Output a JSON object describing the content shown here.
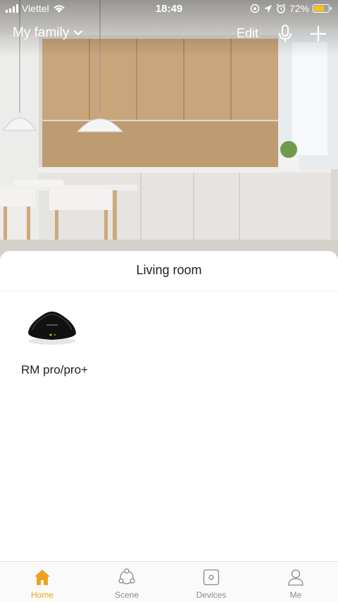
{
  "status_bar": {
    "carrier": "Viettel",
    "time": "18:49",
    "battery_percent": "72%",
    "battery_level": 0.72,
    "icons": [
      "signal-icon",
      "wifi-icon",
      "orientation-lock-icon",
      "location-icon",
      "alarm-icon",
      "battery-charging-icon"
    ]
  },
  "header": {
    "family_name": "My family",
    "edit_label": "Edit",
    "icons": [
      "chevron-down-icon",
      "microphone-icon",
      "plus-icon"
    ]
  },
  "room": {
    "title": "Living room",
    "devices": [
      {
        "name": "RM pro/pro+",
        "icon": "rm-pro-device-image"
      }
    ]
  },
  "tab_bar": {
    "accent_color": "#f0a020",
    "inactive_color": "#8a8a8a",
    "tabs": [
      {
        "label": "Home",
        "icon": "home-icon",
        "active": true
      },
      {
        "label": "Scene",
        "icon": "scene-icon",
        "active": false
      },
      {
        "label": "Devices",
        "icon": "devices-icon",
        "active": false
      },
      {
        "label": "Me",
        "icon": "person-icon",
        "active": false
      }
    ]
  }
}
